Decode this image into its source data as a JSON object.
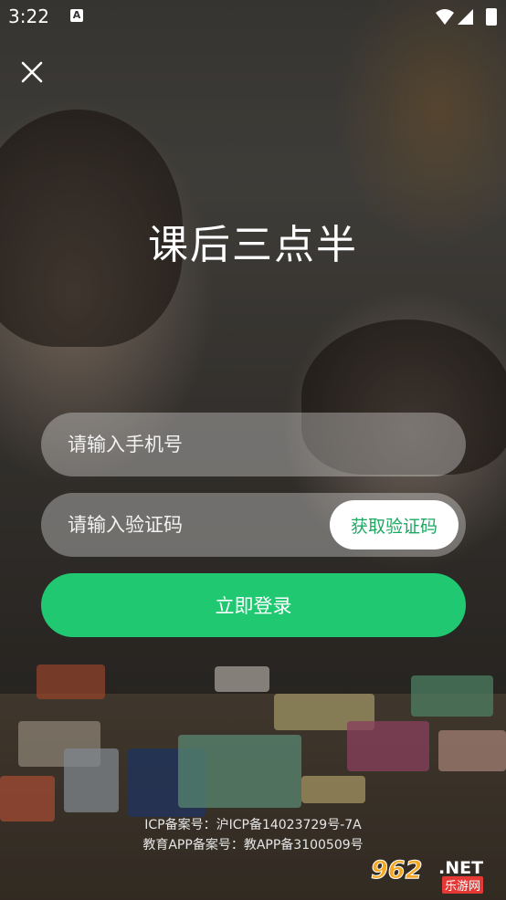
{
  "status_bar": {
    "time": "3:22",
    "notification_icon": "A"
  },
  "header": {
    "close_icon": "close-icon"
  },
  "app": {
    "title": "课后三点半"
  },
  "form": {
    "phone_placeholder": "请输入手机号",
    "code_placeholder": "请输入验证码",
    "get_code_label": "获取验证码",
    "login_label": "立即登录"
  },
  "footer": {
    "icp_line": "ICP备案号：沪ICP备14023729号-7A",
    "app_record_line": "教育APP备案号：教APP备3100509号"
  },
  "watermark": {
    "number": "962",
    "suffix": ".NET",
    "caption": "乐游网"
  },
  "colors": {
    "accent": "#20c871",
    "accent_text": "#1ea862"
  }
}
